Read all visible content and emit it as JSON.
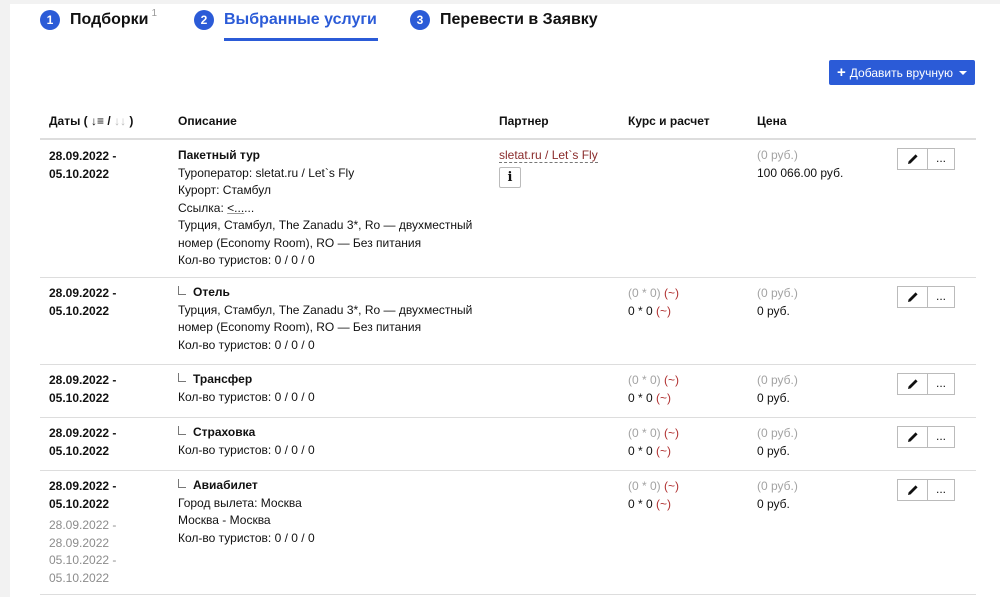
{
  "steps": [
    {
      "num": "1",
      "label": "Подборки",
      "sup": "1"
    },
    {
      "num": "2",
      "label": "Выбранные услуги"
    },
    {
      "num": "3",
      "label": "Перевести в Заявку"
    }
  ],
  "toolbar": {
    "add_label": "Добавить вручную"
  },
  "table": {
    "headers": {
      "dates": "Даты (",
      "dates_sort1": "↓",
      "dates_slash": " / ",
      "dates_sort2": "↓",
      "dates_close": " )",
      "description": "Описание",
      "partner": "Партнер",
      "calc": "Курс и расчет",
      "price": "Цена"
    },
    "rows": [
      {
        "date_from": "28.09.2022 -",
        "date_to": "05.10.2022",
        "title": "Пакетный тур",
        "lines": [
          "Туроператор: sletat.ru / Let`s Fly",
          "Курорт: Стамбул"
        ],
        "link_label": "Ссылка: ",
        "link_text": "<...",
        "link_tail": "...",
        "lines2": [
          "Турция, Стамбул, The Zanadu 3*, Ro — двухместный",
          "номер (Economy Room), RO — Без питания",
          "Кол-во туристов: 0 / 0 / 0"
        ],
        "partner": "sletat.ru / Let`s Fly",
        "info_icon": "i",
        "price_muted": "(0 руб.)",
        "price": "100 066.00 руб."
      },
      {
        "date_from": "28.09.2022 -",
        "date_to": "05.10.2022",
        "title": "Отель",
        "lines": [
          "Турция, Стамбул, The Zanadu 3*, Ro — двухместный",
          "номер (Economy Room), RO — Без питания",
          "Кол-во туристов: 0 / 0 / 0"
        ],
        "calc_muted": "(0 * 0)",
        "calc": "0 * 0",
        "tilde": "(~)",
        "price_muted": "(0 руб.)",
        "price": "0 руб."
      },
      {
        "date_from": "28.09.2022 -",
        "date_to": "05.10.2022",
        "title": "Трансфер",
        "lines": [
          "Кол-во туристов: 0 / 0 / 0"
        ],
        "calc_muted": "(0 * 0)",
        "calc": "0 * 0",
        "tilde": "(~)",
        "price_muted": "(0 руб.)",
        "price": "0 руб."
      },
      {
        "date_from": "28.09.2022 -",
        "date_to": "05.10.2022",
        "title": "Страховка",
        "lines": [
          "Кол-во туристов: 0 / 0 / 0"
        ],
        "calc_muted": "(0 * 0)",
        "calc": "0 * 0",
        "tilde": "(~)",
        "price_muted": "(0 руб.)",
        "price": "0 руб."
      },
      {
        "date_from": "28.09.2022 -",
        "date_to": "05.10.2022",
        "sub_dates": [
          "28.09.2022 -",
          "28.09.2022",
          "05.10.2022 -",
          "05.10.2022"
        ],
        "title": "Авиабилет",
        "lines": [
          "Город вылета: Москва",
          "Москва - Москва",
          "Кол-во туристов: 0 / 0 / 0"
        ],
        "calc_muted": "(0 * 0)",
        "calc": "0 * 0",
        "tilde": "(~)",
        "price_muted": "(0 руб.)",
        "price": "0 руб."
      }
    ],
    "more_label": "..."
  }
}
